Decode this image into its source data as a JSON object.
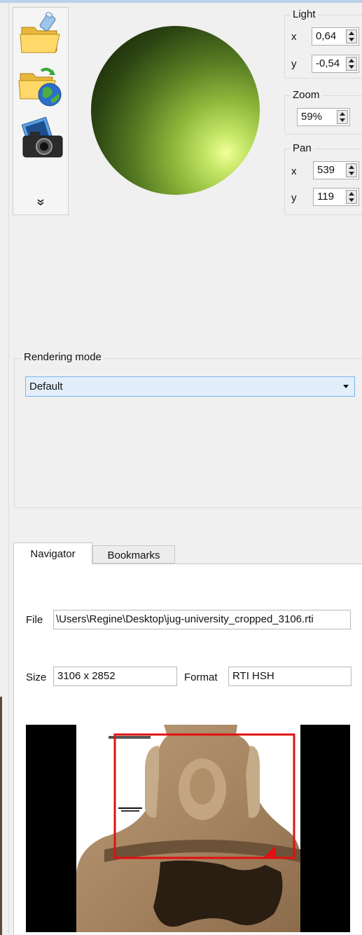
{
  "toolbar": {
    "open_icon": "open-folder-icon",
    "open_remote_icon": "folder-globe-icon",
    "snapshot_icon": "camera-icon",
    "more_icon": "chevron-double-down-icon",
    "more_label": "»"
  },
  "light": {
    "title": "Light",
    "x_label": "x",
    "x_value": "0,64",
    "y_label": "y",
    "y_value": "-0,54"
  },
  "zoom": {
    "title": "Zoom",
    "value": "59%"
  },
  "pan": {
    "title": "Pan",
    "x_label": "x",
    "x_value": "539",
    "y_label": "y",
    "y_value": "119"
  },
  "rendering": {
    "title": "Rendering mode",
    "selected": "Default"
  },
  "tabs": {
    "navigator": "Navigator",
    "bookmarks": "Bookmarks"
  },
  "info": {
    "file_label": "File",
    "file_value": "\\Users\\Regine\\Desktop\\jug-university_cropped_3106.rti",
    "size_label": "Size",
    "size_value": "3106 x 2852",
    "format_label": "Format",
    "format_value": "RTI HSH"
  },
  "colors": {
    "viewport_red": "#e01010",
    "accent": "#7eb4ea"
  }
}
